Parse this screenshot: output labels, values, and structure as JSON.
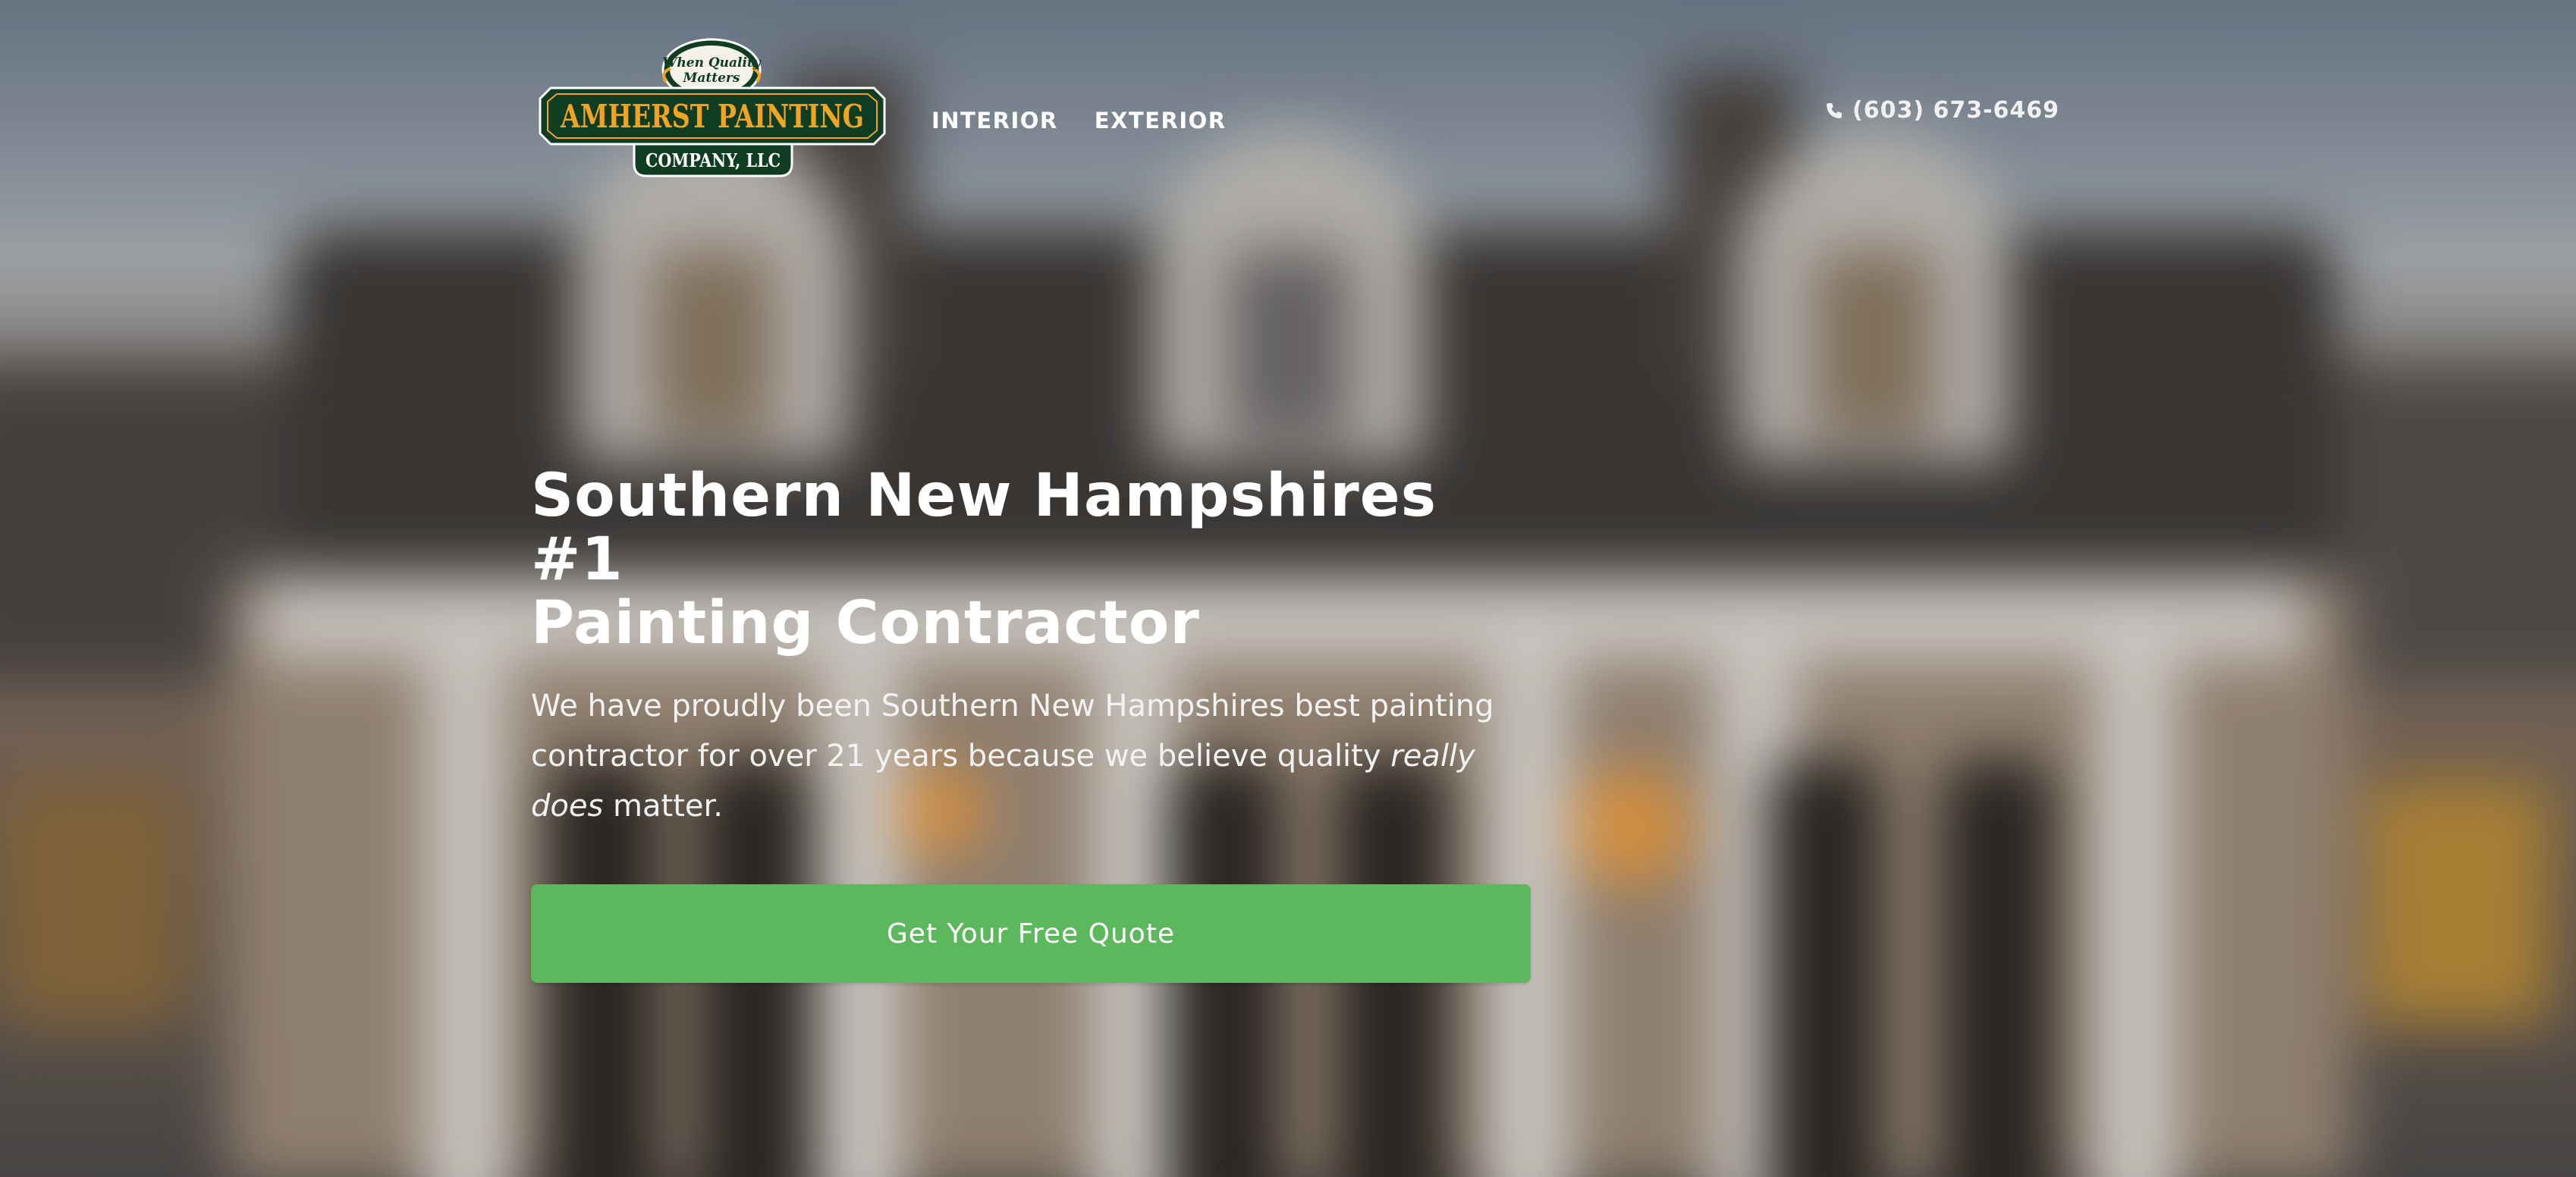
{
  "brand": {
    "logo_tagline": "When Quality Matters",
    "logo_name": "AMHERST PAINTING",
    "logo_company": "COMPANY, LLC",
    "colors": {
      "logo_green": "#0f3d22",
      "logo_gold": "#f2a322",
      "cta_green": "#5cb85c"
    }
  },
  "nav": {
    "items": [
      {
        "label": "INTERIOR"
      },
      {
        "label": "EXTERIOR"
      }
    ]
  },
  "contact": {
    "phone_icon": "phone-icon",
    "phone": "(603) 673-6469"
  },
  "hero": {
    "headline_line1": "Southern New Hampshires #1",
    "headline_line2": "Painting Contractor",
    "lead_before": "We have proudly been Southern New Hampshires best painting contractor for over 21 years because we believe quality ",
    "lead_emphasis": "really does",
    "lead_after": " matter.",
    "cta_label": "Get Your Free Quote"
  }
}
